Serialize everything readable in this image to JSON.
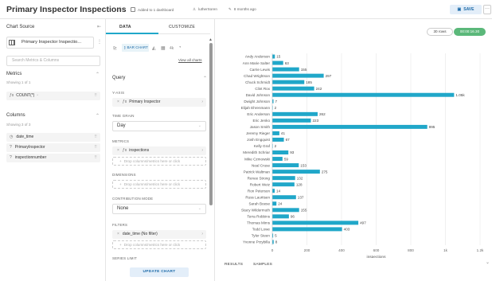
{
  "header": {
    "title": "Primary Inspector Inspections",
    "dashboards": "Added to 1 dashboard",
    "owner": "lutherSoren",
    "modified": "8 months ago",
    "save_label": "SAVE",
    "more_label": "···"
  },
  "left": {
    "chart_source_label": "Chart Source",
    "dataset_name": "Primary Inspector Inspectio...",
    "search_placeholder": "Search Metrics & Columns",
    "metrics_title": "Metrics",
    "metrics_count": "Showing 1 of 1",
    "metrics": [
      {
        "icon": "ƒx",
        "label": "COUNT(*)"
      }
    ],
    "columns_title": "Columns",
    "columns_count": "Showing 3 of 3",
    "columns": [
      {
        "icon": "clock",
        "label": "date_time"
      },
      {
        "icon": "?",
        "label": "PrimaryInspector"
      },
      {
        "icon": "?",
        "label": "inspectionnumber"
      }
    ]
  },
  "middle": {
    "tabs": [
      "DATA",
      "CUSTOMIZE"
    ],
    "viz_type": "BAR CHART",
    "view_all": "View all charts",
    "query_title": "Query",
    "y_axis_label": "Y-AXIS",
    "y_axis_value": "Primary Inspector",
    "time_grain_label": "TIME GRAIN",
    "time_grain_value": "Day",
    "metrics_label": "METRICS",
    "metrics_value": "inspections",
    "drop_hint": "Drop columns/metrics here or click",
    "dimensions_label": "DIMENSIONS",
    "contribution_label": "CONTRIBUTION MODE",
    "contribution_value": "None",
    "filters_label": "FILTERS",
    "filter_value": "date_time (No filter)",
    "series_limit_label": "SERIES LIMIT",
    "update_label": "UPDATE CHART"
  },
  "right": {
    "rows": "30 rows",
    "time": "00:00:16.30",
    "bottom_tabs": [
      "RESULTS",
      "SAMPLES"
    ]
  },
  "chart_data": {
    "type": "bar",
    "orientation": "horizontal",
    "categories": [
      "Andy Anderson",
      "Ann Marie Salter",
      "Carrie Lewis",
      "Chad Wrightson",
      "Chuck Schmidt",
      "Clint Rox",
      "David Johnson",
      "Dwight Johnson",
      "Elijah Ehrenmann",
      "Eric Anderson",
      "Eric Jenko",
      "Jason Smith",
      "Jeremy Rieger",
      "Josh Engquist",
      "Kelly Graf",
      "Meredith Schriar",
      "Mike Czmowski",
      "Neal Cruse",
      "Patrick Waltman",
      "Renee Strong",
      "Robert Weiz",
      "Ron Peterson",
      "Russ Lauritsen",
      "Sarah Boese",
      "Stacy Wildermuth",
      "Terra Robbins",
      "Thomas Mims",
      "Todd Lowe",
      "Tyler Steen",
      "Yvonne Przybilla"
    ],
    "values": [
      15,
      63,
      155,
      297,
      185,
      242,
      1050,
      7,
      2,
      262,
      223,
      895,
      41,
      67,
      2,
      93,
      59,
      153,
      275,
      132,
      128,
      14,
      137,
      24,
      155,
      96,
      497,
      403,
      5,
      8
    ],
    "data_labels": [
      "15",
      "63",
      "155",
      "297",
      "185",
      "242",
      "1.05k",
      "7",
      "2",
      "262",
      "223",
      "895",
      "41",
      "67",
      "2",
      "93",
      "59",
      "153",
      "275",
      "132",
      "128",
      "14",
      "137",
      "24",
      "155",
      "96",
      "497",
      "403",
      "5",
      "8"
    ],
    "xlabel": "inspections",
    "ylabel": "",
    "xlim": [
      0,
      1200
    ],
    "xticks": [
      "0",
      "200",
      "400",
      "600",
      "800",
      "1k",
      "1.2k"
    ],
    "xtick_values": [
      0,
      200,
      400,
      600,
      800,
      1000,
      1200
    ],
    "bar_color": "#20a7c9",
    "grid": true
  }
}
